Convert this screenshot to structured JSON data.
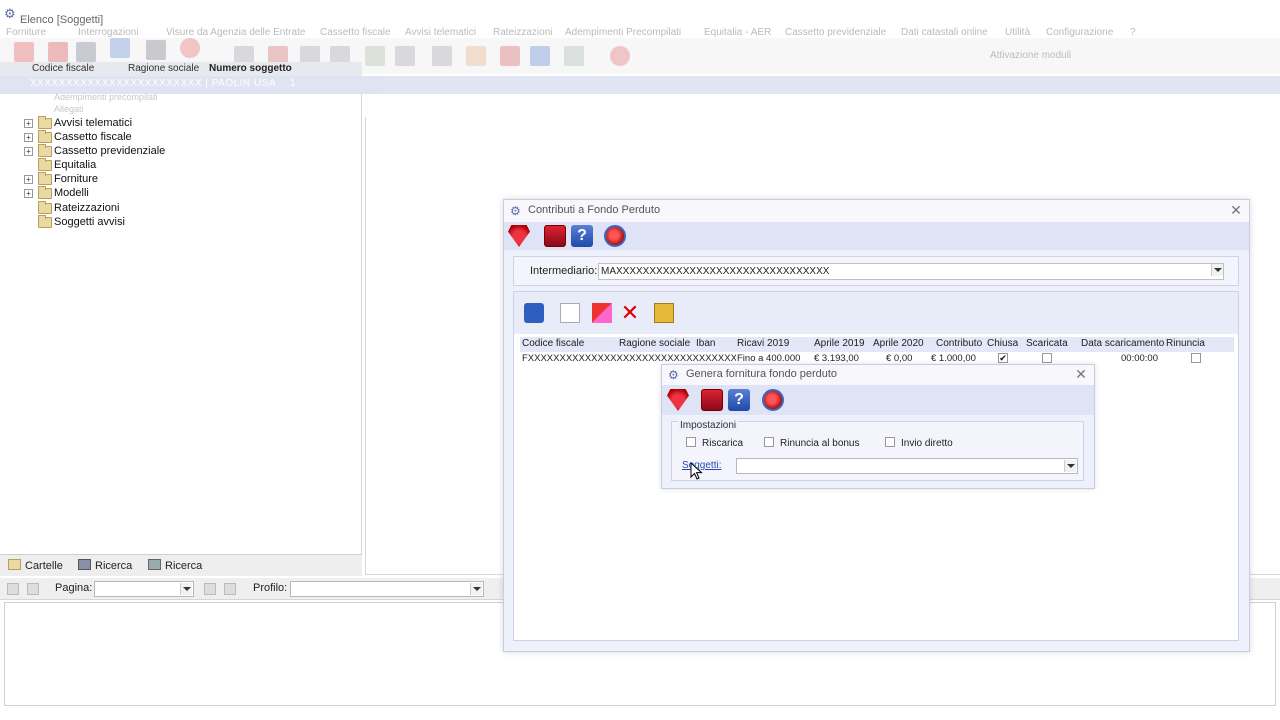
{
  "app": {
    "title": "Elenco [Soggetti]",
    "menu": [
      "Forniture",
      "Interrogazioni",
      "Visure da Agenzia delle Entrate",
      "Cassetto fiscale",
      "Avvisi telematici",
      "Rateizzazioni",
      "Adempimenti Precompilati",
      "Equitalia - AER",
      "Cassetto previdenziale",
      "Dati catastali online",
      "Utilità",
      "Configurazione",
      "?"
    ],
    "attivazione_label": "Attivazione moduli"
  },
  "tree": {
    "columns": [
      "Codice fiscale",
      "Ragione sociale",
      "Numero soggetto"
    ],
    "selected_row": {
      "text": "XXXXXXXXXXXXXXXXXXXXXXXX  |  PAOLIN USA",
      "number": "1"
    },
    "faded_items": [
      "Adempimenti precompilati",
      "Allegati"
    ],
    "items": [
      {
        "label": "Avvisi telematici",
        "expand": "+"
      },
      {
        "label": "Cassetto fiscale",
        "expand": "+"
      },
      {
        "label": "Cassetto previdenziale",
        "expand": "+"
      },
      {
        "label": "Equitalia",
        "expand": ""
      },
      {
        "label": "Forniture",
        "expand": "+"
      },
      {
        "label": "Modelli",
        "expand": "+"
      },
      {
        "label": "Rateizzazioni",
        "expand": ""
      },
      {
        "label": "Soggetti avvisi",
        "expand": ""
      }
    ]
  },
  "bottom_tabs": [
    "Cartelle",
    "Ricerca",
    "Ricerca"
  ],
  "pager": {
    "page_label": "Pagina:",
    "profile_label": "Profilo:",
    "page_value": "",
    "profile_value": ""
  },
  "contributi": {
    "title": "Contributi a Fondo Perduto",
    "intermediario_label": "Intermediario:",
    "intermediario_value": "MAXXXXXXXXXXXXXXXXXXXXXXXXXXXXXXXX",
    "grid": {
      "columns": [
        "Codice fiscale",
        "Ragione sociale",
        "Iban",
        "Ricavi 2019",
        "Aprile 2019",
        "Aprile 2020",
        "Contributo",
        "Chiusa",
        "Scaricata",
        "Data scaricamento",
        "Rinuncia"
      ],
      "rows": [
        {
          "codice_fiscale": "FXXXXXXXXXXXXXXXXXXXXXXXXXXXXXXXXXX",
          "ricavi": "Fino a 400.000",
          "aprile_2019": "€ 3.193,00",
          "aprile_2020": "€ 0,00",
          "contributo": "€ 1.000,00",
          "chiusa": "✔",
          "scaricata": "",
          "data_scaricamento": "00:00:00",
          "rinuncia": ""
        }
      ]
    }
  },
  "genera": {
    "title": "Genera fornitura fondo perduto",
    "group_label": "Impostazioni",
    "options": [
      "Riscarica",
      "Rinuncia al bonus",
      "Invio diretto"
    ],
    "soggetti_label": "Soggetti:",
    "soggetti_value": ""
  },
  "icons": {
    "close": "close-icon",
    "signature": "signature-icon",
    "book": "book-icon",
    "help": "help-icon",
    "exit": "exit-icon"
  },
  "colors": {
    "window_bg": "#eef0fb",
    "toolbar_bg": "#dfe3f6",
    "link": "#2649b6",
    "selection": "#c8cee8"
  }
}
